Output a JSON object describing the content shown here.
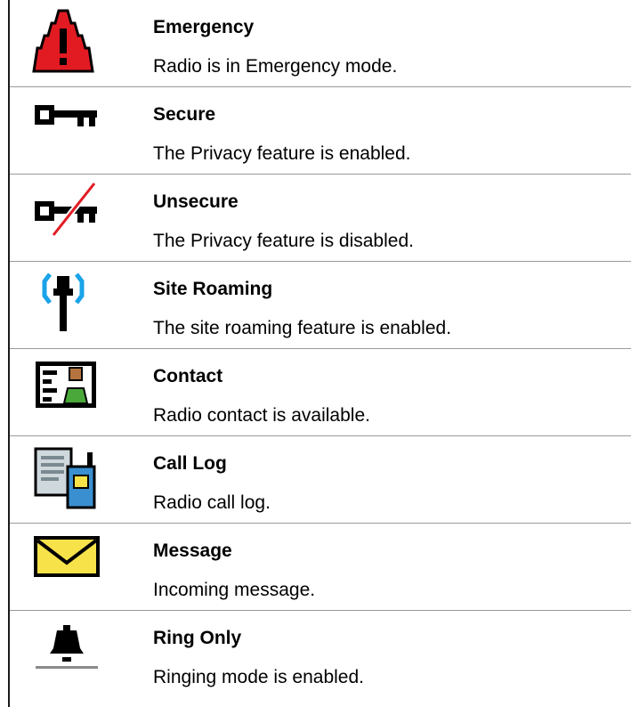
{
  "entries": [
    {
      "title": "Emergency",
      "description": "Radio is in Emergency mode.",
      "icon": "emergency-icon"
    },
    {
      "title": "Secure",
      "description": "The Privacy feature is enabled.",
      "icon": "secure-key-icon"
    },
    {
      "title": "Unsecure",
      "description": "The Privacy feature is disabled.",
      "icon": "unsecure-key-icon"
    },
    {
      "title": "Site Roaming",
      "description": "The site roaming feature is enabled.",
      "icon": "site-roaming-icon"
    },
    {
      "title": "Contact",
      "description": "Radio contact is available.",
      "icon": "contact-card-icon"
    },
    {
      "title": "Call Log",
      "description": "Radio call log.",
      "icon": "call-log-icon"
    },
    {
      "title": "Message",
      "description": "Incoming message.",
      "icon": "envelope-icon"
    },
    {
      "title": "Ring Only",
      "description": "Ringing mode is enabled.",
      "icon": "bell-icon"
    }
  ],
  "colors": {
    "emergency_red": "#e21b23",
    "roaming_blue": "#1aa3e8",
    "envelope_yellow": "#f7e24a",
    "contact_green": "#4aa83a",
    "contact_skin": "#b5743f",
    "radio_blue": "#3a8fd0",
    "document_gray": "#cfd8dc",
    "bell_gray": "#8a8a8a"
  }
}
